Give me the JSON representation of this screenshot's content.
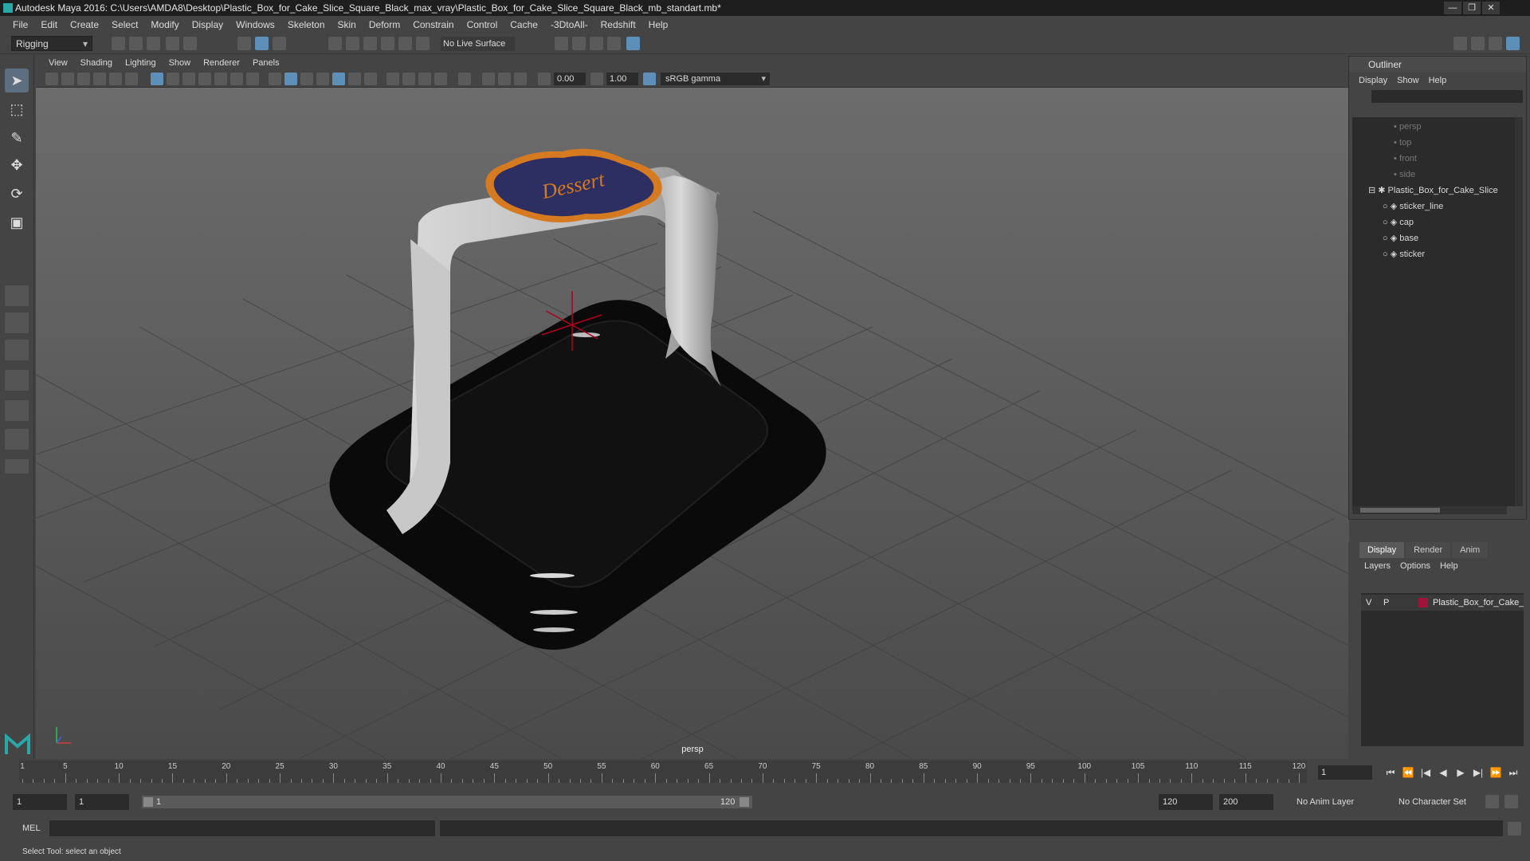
{
  "window": {
    "title": "Autodesk Maya 2016: C:\\Users\\AMDA8\\Desktop\\Plastic_Box_for_Cake_Slice_Square_Black_max_vray\\Plastic_Box_for_Cake_Slice_Square_Black_mb_standart.mb*",
    "controls": [
      "—",
      "❐",
      "✕"
    ]
  },
  "menubar": [
    "File",
    "Edit",
    "Create",
    "Select",
    "Modify",
    "Display",
    "Windows",
    "Skeleton",
    "Skin",
    "Deform",
    "Constrain",
    "Control",
    "Cache",
    "-3DtoAll-",
    "Redshift",
    "Help"
  ],
  "shelf": {
    "mode": "Rigging",
    "live_surface": "No Live Surface"
  },
  "viewport": {
    "menu": [
      "View",
      "Shading",
      "Lighting",
      "Show",
      "Renderer",
      "Panels"
    ],
    "exposure": "0.00",
    "gamma": "1.00",
    "color_space": "sRGB gamma",
    "camera": "persp",
    "sticker_text": "Dessert"
  },
  "outliner": {
    "title": "Outliner",
    "menu": [
      "Display",
      "Show",
      "Help"
    ],
    "items": [
      {
        "label": "persp",
        "dim": true
      },
      {
        "label": "top",
        "dim": true
      },
      {
        "label": "front",
        "dim": true
      },
      {
        "label": "side",
        "dim": true
      },
      {
        "label": "Plastic_Box_for_Cake_Slice",
        "dim": false
      },
      {
        "label": "sticker_line",
        "dim": false
      },
      {
        "label": "cap",
        "dim": false
      },
      {
        "label": "base",
        "dim": false
      },
      {
        "label": "sticker",
        "dim": false
      }
    ]
  },
  "layers": {
    "tabs": [
      "Display",
      "Render",
      "Anim"
    ],
    "menu": [
      "Layers",
      "Options",
      "Help"
    ],
    "row": {
      "v": "V",
      "p": "P",
      "name": "Plastic_Box_for_Cake_S",
      "color": "#a0143a"
    }
  },
  "timeline": {
    "labels": [
      "5",
      "10",
      "15",
      "20",
      "25",
      "30",
      "35",
      "40",
      "45",
      "50",
      "55",
      "60",
      "65",
      "70",
      "75",
      "80",
      "85",
      "90",
      "95",
      "100",
      "105",
      "110",
      "115",
      "120"
    ],
    "start_marker": "1",
    "current_frame": "1"
  },
  "range": {
    "start": "1",
    "playback_start": "1",
    "slider_start": "1",
    "slider_end": "120",
    "playback_end": "120",
    "end": "200",
    "anim_layer": "No Anim Layer",
    "char_set": "No Character Set"
  },
  "cmd": {
    "label": "MEL"
  },
  "status": "Select Tool: select an object"
}
